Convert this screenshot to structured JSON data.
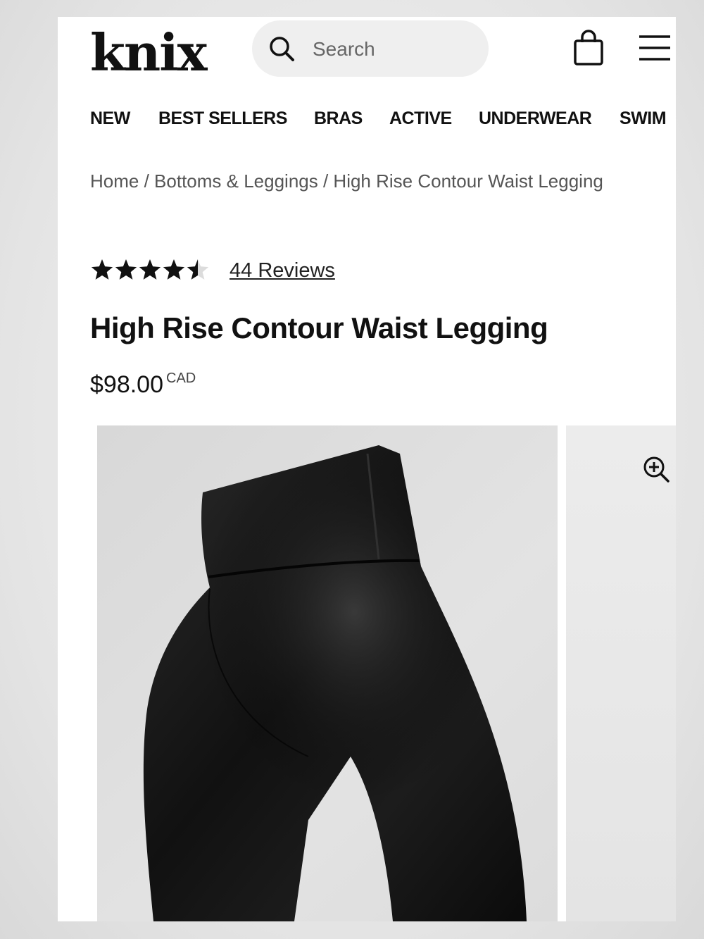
{
  "brand": {
    "logo_text": "knix"
  },
  "search": {
    "placeholder": "Search"
  },
  "header_icons": {
    "search": "search-icon",
    "bag": "shopping-bag-icon",
    "menu": "hamburger-menu-icon"
  },
  "nav": {
    "items": [
      {
        "label": "NEW"
      },
      {
        "label": "BEST SELLERS"
      },
      {
        "label": "BRAS"
      },
      {
        "label": "ACTIVE"
      },
      {
        "label": "UNDERWEAR"
      },
      {
        "label": "SWIM"
      }
    ]
  },
  "breadcrumb": {
    "home": "Home",
    "category": "/ Bottoms & Leggings",
    "current": "/ High Rise Contour Waist Legging"
  },
  "product": {
    "rating": 4.5,
    "rating_max": 5,
    "reviews_label": "44 Reviews",
    "title": "High Rise Contour Waist Legging",
    "price": "$98.00",
    "currency": "CAD"
  },
  "gallery": {
    "zoom_icon": "zoom-in-icon"
  },
  "colors": {
    "text": "#111111",
    "muted": "#555555",
    "search_bg": "#efefef",
    "legging": "#141414"
  }
}
